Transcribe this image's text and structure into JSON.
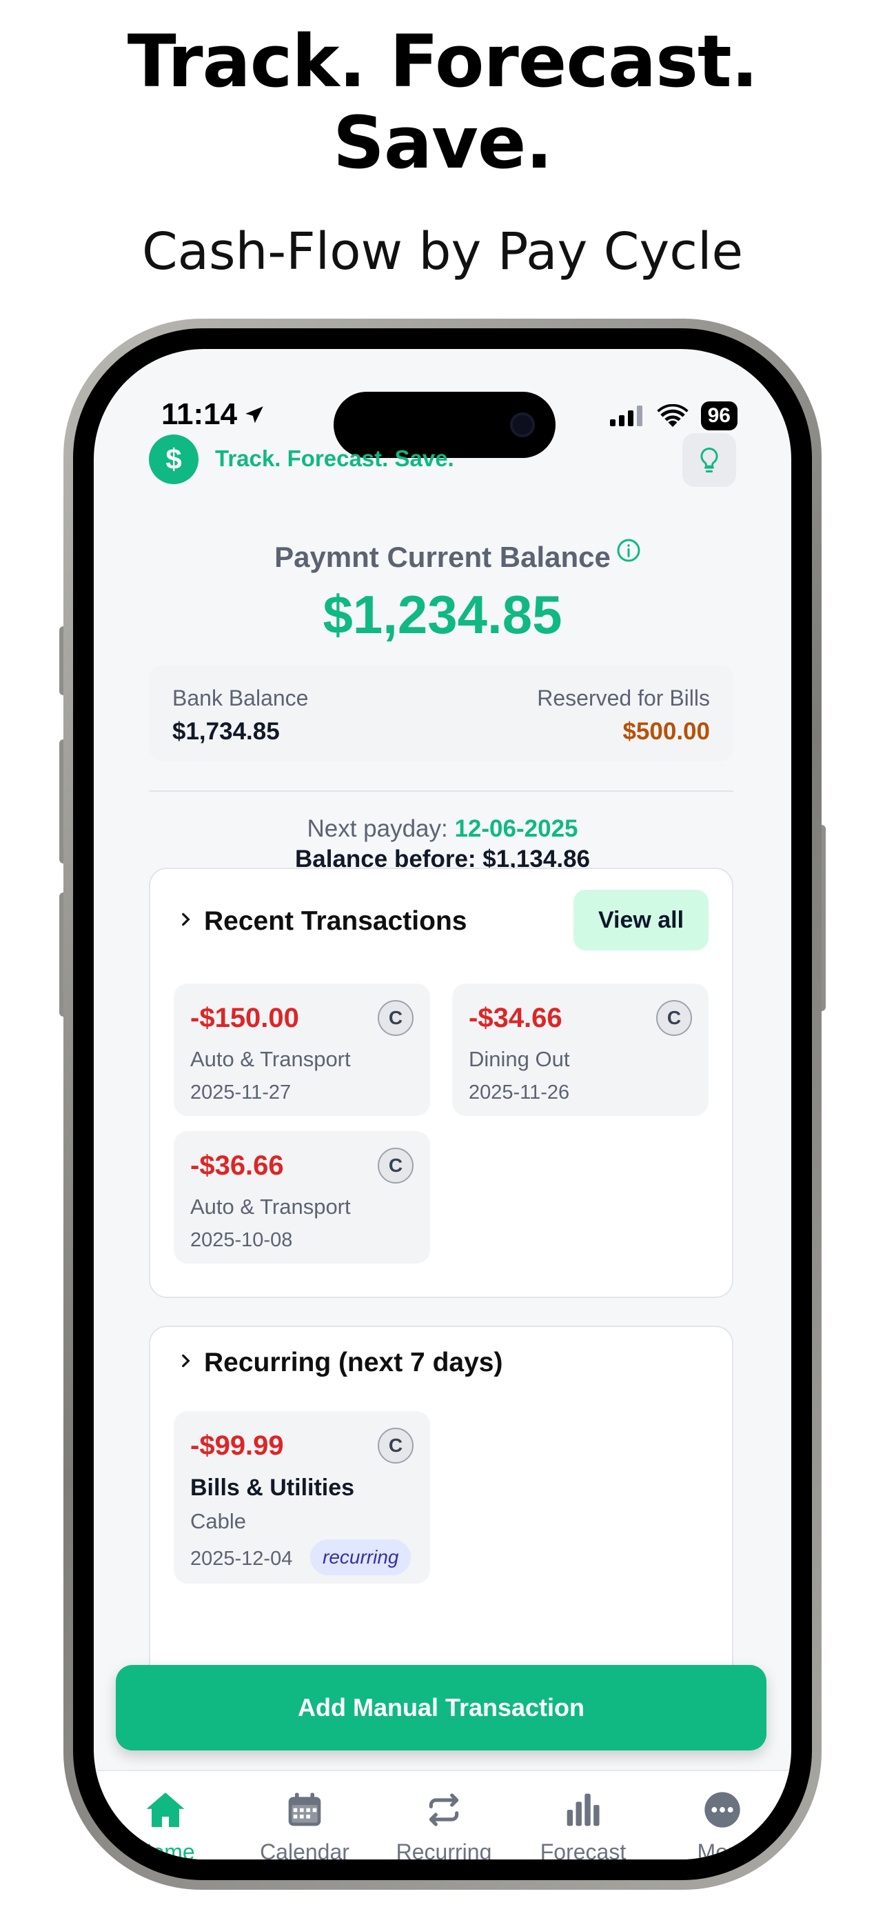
{
  "promo": {
    "headline_line1": "Track. Forecast.",
    "headline_line2": "Save.",
    "subheadline": "Cash-Flow by Pay Cycle"
  },
  "status_bar": {
    "time": "11:14",
    "battery": "96"
  },
  "header": {
    "logo_symbol": "$",
    "title": "Track. Forecast. Save.",
    "tip_icon": "lightbulb-icon"
  },
  "balance": {
    "label": "Paymnt Current Balance",
    "amount": "$1,234.85",
    "bank_label": "Bank Balance",
    "bank_value": "$1,734.85",
    "reserved_label": "Reserved for Bills",
    "reserved_value": "$500.00"
  },
  "payday": {
    "prefix": "Next payday: ",
    "date": "12-06-2025",
    "balance_before": "Balance before: $1,134.86"
  },
  "recent": {
    "title": "Recent Transactions",
    "view_all": "View all",
    "items": [
      {
        "amount": "-$150.00",
        "category": "Auto & Transport",
        "date": "2025-11-27",
        "badge": "C"
      },
      {
        "amount": "-$34.66",
        "category": "Dining Out",
        "date": "2025-11-26",
        "badge": "C"
      },
      {
        "amount": "-$36.66",
        "category": "Auto & Transport",
        "date": "2025-10-08",
        "badge": "C"
      }
    ]
  },
  "recurring": {
    "title": "Recurring (next 7 days)",
    "items": [
      {
        "amount": "-$99.99",
        "category": "Bills & Utilities",
        "name": "Cable",
        "date": "2025-12-04",
        "tag": "recurring",
        "badge": "C"
      }
    ]
  },
  "actions": {
    "add_manual": "Add Manual Transaction"
  },
  "tabs": [
    {
      "label": "Home",
      "icon": "home-icon",
      "active": true
    },
    {
      "label": "Calendar",
      "icon": "calendar-icon",
      "active": false
    },
    {
      "label": "Recurring",
      "icon": "repeat-icon",
      "active": false
    },
    {
      "label": "Forecast",
      "icon": "bar-chart-icon",
      "active": false
    },
    {
      "label": "More",
      "icon": "more-icon",
      "active": false
    }
  ],
  "colors": {
    "brand": "#10b981",
    "negative": "#dc2626",
    "reserved": "#b45309",
    "muted": "#5b6373"
  }
}
